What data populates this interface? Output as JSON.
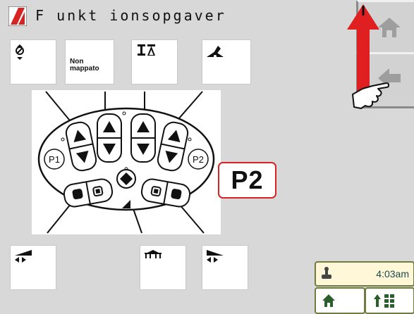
{
  "header": {
    "title": "F unkt ionsopgaver"
  },
  "slots": {
    "top_2_label": "Non mappato"
  },
  "badge": {
    "label": "P2"
  },
  "joystick": {
    "p1_label": "P1",
    "p2_label": "P2"
  },
  "status": {
    "time": "4:03am"
  },
  "colors": {
    "highlight": "#d62424",
    "arrow": "#e02020",
    "status_bg": "#fff7d8",
    "status_border": "#6e7c40"
  }
}
